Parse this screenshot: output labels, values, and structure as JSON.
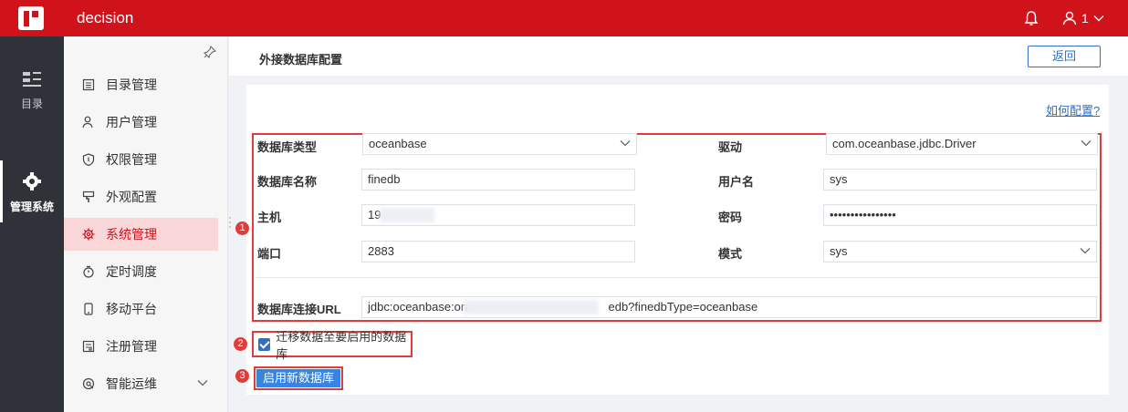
{
  "topbar": {
    "app_name": "decision",
    "user_label": "1",
    "bg_color": "#d0121b"
  },
  "rail": {
    "items": [
      {
        "label": "目录",
        "icon": "catalog-icon",
        "active": false
      },
      {
        "label": "管理系统",
        "icon": "gear-icon",
        "active": true
      }
    ]
  },
  "menu": {
    "items": [
      {
        "label": "目录管理",
        "icon": "list-icon"
      },
      {
        "label": "用户管理",
        "icon": "user-icon"
      },
      {
        "label": "权限管理",
        "icon": "shield-icon"
      },
      {
        "label": "外观配置",
        "icon": "brush-icon"
      },
      {
        "label": "系统管理",
        "icon": "gear-icon",
        "active": true
      },
      {
        "label": "定时调度",
        "icon": "timer-icon"
      },
      {
        "label": "移动平台",
        "icon": "mobile-icon"
      },
      {
        "label": "注册管理",
        "icon": "register-icon"
      },
      {
        "label": "智能运维",
        "icon": "ops-icon",
        "expandable": true
      }
    ]
  },
  "header": {
    "title": "外接数据库配置",
    "back_label": "返回"
  },
  "panel": {
    "help_link": "如何配置?",
    "fields": {
      "db_type": {
        "label": "数据库类型",
        "value": "oceanbase"
      },
      "driver": {
        "label": "驱动",
        "value": "com.oceanbase.jdbc.Driver"
      },
      "db_name": {
        "label": "数据库名称",
        "value": "finedb"
      },
      "username": {
        "label": "用户名",
        "value": "sys"
      },
      "host": {
        "label": "主机",
        "value": "19"
      },
      "password": {
        "label": "密码",
        "value": "••••••••••••••••"
      },
      "port": {
        "label": "端口",
        "value": "2883"
      },
      "schema": {
        "label": "模式",
        "value": "sys"
      },
      "url": {
        "label": "数据库连接URL",
        "value_prefix": "jdbc:oceanbase:ora",
        "value_suffix": "edb?finedbType=oceanbase"
      }
    },
    "migrate": {
      "label": "迁移数据至要启用的数据库",
      "checked": true
    },
    "enable_label": "启用新数据库",
    "step_badges": [
      "1",
      "2",
      "3"
    ],
    "accent_color": "#2f6fc7",
    "highlight_color": "#e03c3c"
  }
}
